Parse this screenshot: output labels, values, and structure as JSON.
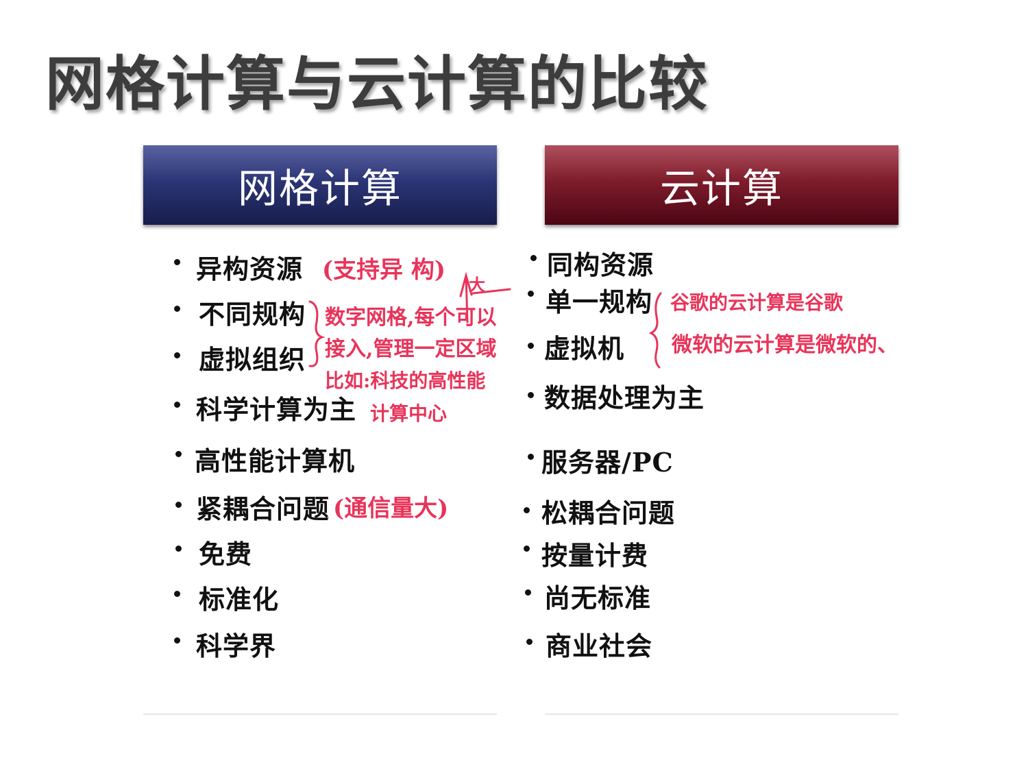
{
  "title": "网格计算与云计算的比较",
  "grid": {
    "header": "网格计算",
    "items": [
      "异构资源",
      "不同规构",
      "虚拟组织",
      "科学计算为主",
      "高性能计算机",
      "紧耦合问题",
      "免费",
      "标准化",
      "科学界"
    ]
  },
  "cloud": {
    "header": "云计算",
    "items": [
      "同构资源",
      "单一规构",
      "虚拟机",
      "数据处理为主",
      "服务器/PC",
      "松耦合问题",
      "按量计费",
      "尚无标准",
      "商业社会"
    ]
  },
  "annotations": {
    "hetero": "(支持异 构)",
    "big": "大",
    "grid_note_1": "数字网格,每个可以",
    "grid_note_2": "接入,管理一定区域",
    "grid_note_3": "比如:科技的高性能",
    "grid_note_4": "计算中心",
    "traffic": "(通信量大)",
    "cloud_note_1": "谷歌的云计算是谷歌",
    "cloud_note_2": "微软的云计算是微软的、"
  },
  "colors": {
    "grid_header": "#2c3575",
    "cloud_header": "#7e1c2c",
    "ink_red": "#e8345a"
  }
}
